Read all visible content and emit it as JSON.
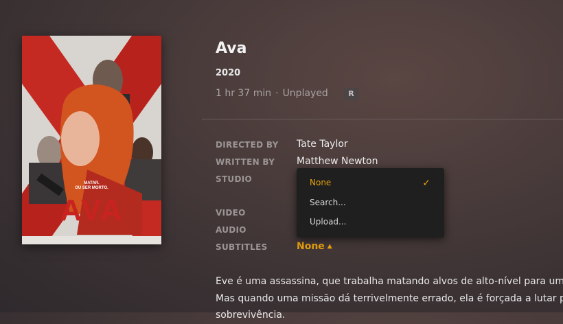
{
  "movie": {
    "title": "Ava",
    "year": "2020",
    "duration": "1 hr 37 min",
    "separator": "·",
    "watch_status": "Unplayed",
    "rating": "R"
  },
  "poster": {
    "logo_text": "AVA",
    "tagline_line1": "MATAR.",
    "tagline_line2": "OU SER MORTO."
  },
  "details": {
    "directed_by_label": "DIRECTED BY",
    "directed_by_value": "Tate Taylor",
    "written_by_label": "WRITTEN BY",
    "written_by_value": "Matthew Newton",
    "studio_label": "STUDIO",
    "video_label": "VIDEO",
    "audio_label": "AUDIO",
    "subtitles_label": "SUBTITLES",
    "subtitles_value": "None",
    "subtitles_caret": "▲"
  },
  "subtitle_dropdown": {
    "items": [
      {
        "label": "None",
        "selected": true
      },
      {
        "label": "Search...",
        "selected": false
      },
      {
        "label": "Upload...",
        "selected": false
      }
    ],
    "check": "✓"
  },
  "summary": {
    "line1": "Eve é uma assassina, que trabalha matando alvos de alto-nível para um",
    "line2": "Mas quando uma missão dá terrivelmente errado, ela é forçada a lutar p",
    "line3": "sobrevivência."
  },
  "colors": {
    "accent": "#e5a00d",
    "poster_red": "#c8231f"
  }
}
